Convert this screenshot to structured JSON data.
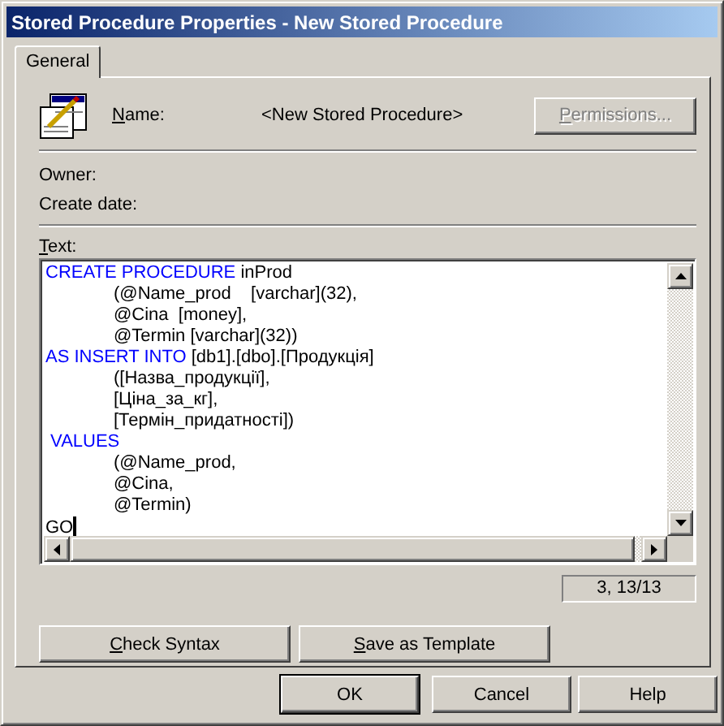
{
  "window": {
    "title": "Stored Procedure Properties - New Stored Procedure"
  },
  "tabs": [
    {
      "label": "General",
      "selected": true
    }
  ],
  "name_field": {
    "label": "Name:",
    "underline_first": true,
    "value": "<New Stored Procedure>"
  },
  "permissions_button": {
    "label": "Permissions...",
    "disabled": true,
    "underline_first": true
  },
  "owner_label": "Owner:",
  "create_date_label": "Create date:",
  "text_label": {
    "label": "Text:",
    "underline_first": true
  },
  "code_lines": [
    {
      "indented": false,
      "segments": [
        {
          "kind": "keyword",
          "text": "CREATE PROCEDURE"
        },
        {
          "kind": "plain",
          "text": " inProd"
        }
      ]
    },
    {
      "indented": true,
      "segments": [
        {
          "kind": "plain",
          "text": "(@Name_prod    [varchar](32),"
        }
      ]
    },
    {
      "indented": true,
      "segments": [
        {
          "kind": "plain",
          "text": "@Cina  [money],"
        }
      ]
    },
    {
      "indented": true,
      "segments": [
        {
          "kind": "plain",
          "text": "@Termin [varchar](32))"
        }
      ]
    },
    {
      "indented": false,
      "segments": [
        {
          "kind": "keyword",
          "text": "AS INSERT INTO"
        },
        {
          "kind": "plain",
          "text": " [db1].[dbo].[Продукція]"
        }
      ]
    },
    {
      "indented": true,
      "segments": [
        {
          "kind": "plain",
          "text": "([Назва_продукції],"
        }
      ]
    },
    {
      "indented": true,
      "segments": [
        {
          "kind": "plain",
          "text": "[Ціна_за_кг],"
        }
      ]
    },
    {
      "indented": true,
      "segments": [
        {
          "kind": "plain",
          "text": "[Термін_придатності])"
        }
      ]
    },
    {
      "indented": false,
      "segments": [
        {
          "kind": "keyword",
          "text": " VALUES"
        }
      ]
    },
    {
      "indented": true,
      "segments": [
        {
          "kind": "plain",
          "text": "(@Name_prod,"
        }
      ]
    },
    {
      "indented": true,
      "segments": [
        {
          "kind": "plain",
          "text": "@Cina,"
        }
      ]
    },
    {
      "indented": true,
      "segments": [
        {
          "kind": "plain",
          "text": "@Termin)"
        }
      ]
    },
    {
      "indented": false,
      "segments": [
        {
          "kind": "plain",
          "text": "GO"
        }
      ],
      "cursor": true
    }
  ],
  "position": "3, 13/13",
  "panel_buttons": [
    {
      "label": "Check Syntax",
      "underline_first": true
    },
    {
      "label": "Save as Template",
      "underline_first": true
    }
  ],
  "dialog_buttons": [
    {
      "label": "OK",
      "default": true
    },
    {
      "label": "Cancel",
      "default": false
    },
    {
      "label": "Help",
      "default": false
    }
  ]
}
